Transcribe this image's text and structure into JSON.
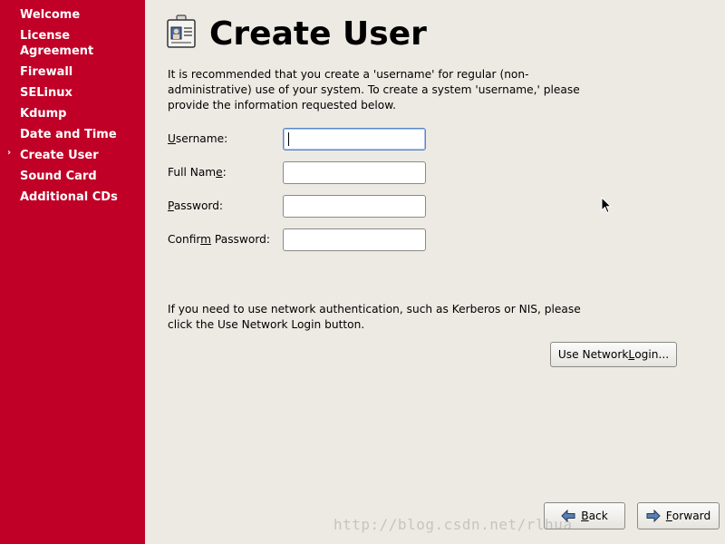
{
  "sidebar": {
    "steps": [
      {
        "label": "Welcome"
      },
      {
        "label": "License Agreement"
      },
      {
        "label": "Firewall"
      },
      {
        "label": "SELinux"
      },
      {
        "label": "Kdump"
      },
      {
        "label": "Date and Time"
      },
      {
        "label": "Create User",
        "current": true
      },
      {
        "label": "Sound Card"
      },
      {
        "label": "Additional CDs"
      }
    ],
    "current_marker": "›"
  },
  "page": {
    "title": "Create User",
    "title_icon": "id-badge-icon",
    "intro_lines": [
      "It is recommended that you create a 'username' for regular (non-",
      "administrative) use of your system. To create a system 'username,' please",
      "provide the information requested below."
    ],
    "fields": [
      {
        "pre": "",
        "mnemonic": "U",
        "post": "sername:",
        "value": "",
        "focused": true
      },
      {
        "pre": "Full Nam",
        "mnemonic": "e",
        "post": ":",
        "value": ""
      },
      {
        "pre": "",
        "mnemonic": "P",
        "post": "assword:",
        "value": ""
      },
      {
        "pre": "Confir",
        "mnemonic": "m",
        "post": " Password:",
        "value": ""
      }
    ],
    "network_lines": [
      "If you need to use network authentication, such as Kerberos or NIS, please",
      "click the Use Network Login button."
    ],
    "network_button": {
      "pre": "Use Network ",
      "mnemonic": "L",
      "post": "ogin..."
    }
  },
  "nav": {
    "back": {
      "pre": "",
      "mnemonic": "B",
      "post": "ack",
      "icon": "arrow-left-icon"
    },
    "forward": {
      "pre": "",
      "mnemonic": "F",
      "post": "orward",
      "icon": "arrow-right-icon"
    }
  },
  "watermark": "http://blog.csdn.net/rlhua",
  "colors": {
    "sidebar": "#c00026",
    "background": "#edeae4",
    "sidebar_text": "#ffffff"
  }
}
